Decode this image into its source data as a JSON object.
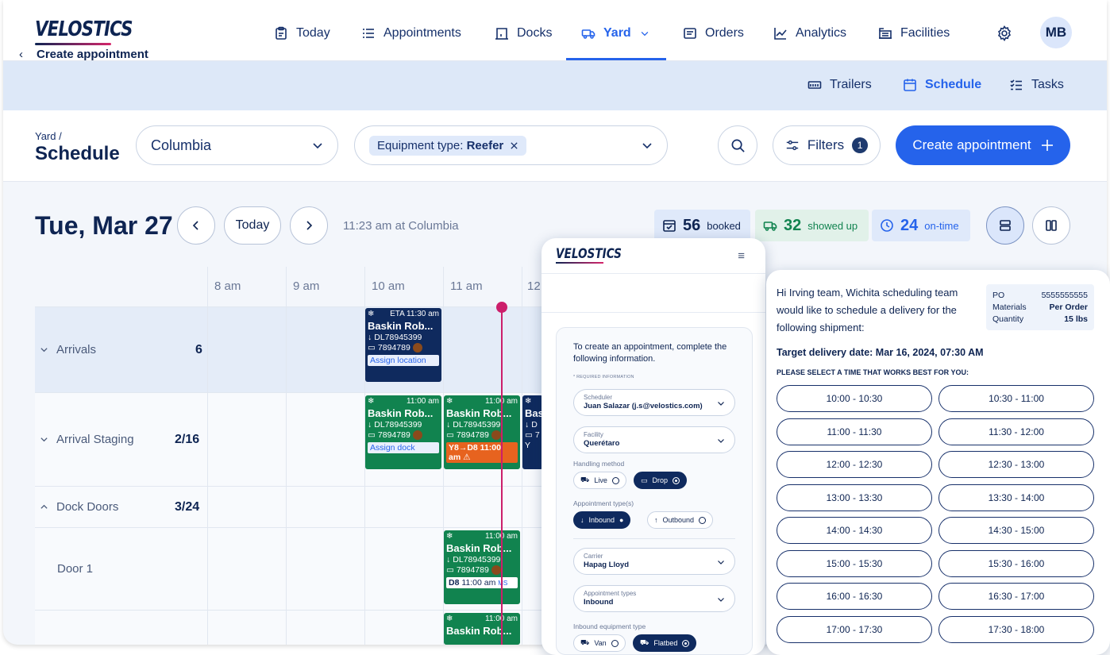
{
  "brand": "VELOSTICS",
  "nav": {
    "items": [
      {
        "label": "Today",
        "icon": "clipboard-icon"
      },
      {
        "label": "Appointments",
        "icon": "list-icon"
      },
      {
        "label": "Docks",
        "icon": "dock-icon"
      },
      {
        "label": "Yard",
        "icon": "truck-icon",
        "active": true
      },
      {
        "label": "Orders",
        "icon": "orders-icon"
      },
      {
        "label": "Analytics",
        "icon": "chart-line-icon"
      },
      {
        "label": "Facilities",
        "icon": "facility-icon"
      }
    ],
    "user_initials": "MB"
  },
  "subnav": {
    "trailers": "Trailers",
    "schedule": "Schedule",
    "tasks": "Tasks"
  },
  "filterbar": {
    "crumb": "Yard /",
    "title": "Schedule",
    "facility": "Columbia",
    "equipment_label": "Equipment type:",
    "equipment_value": "Reefer",
    "filters_label": "Filters",
    "filters_count": "1",
    "create_label": "Create appointment"
  },
  "schedule": {
    "date": "Tue, Mar 27",
    "today_label": "Today",
    "time_note": "11:23 am at Columbia",
    "stats": {
      "booked_num": "56",
      "booked_label": "booked",
      "showed_num": "32",
      "showed_label": "showed up",
      "ontime_num": "24",
      "ontime_label": "on-time"
    },
    "hours": [
      "8 am",
      "9 am",
      "10 am",
      "11 am",
      "12"
    ],
    "rows": [
      {
        "label": "Arrivals",
        "count": "6"
      },
      {
        "label": "Arrival Staging",
        "count": "2/16"
      },
      {
        "label": "Dock Doors",
        "count": "3/24"
      },
      {
        "label": "Door 1",
        "count": ""
      }
    ],
    "cards": {
      "arrival": {
        "time": "ETA 11:30 am",
        "name": "Baskin Rob...",
        "load": "DL78945399",
        "trailer": "7894789",
        "action": "Assign location"
      },
      "staging1": {
        "time": "11:00 am",
        "name": "Baskin Rob...",
        "load": "DL78945399",
        "trailer": "7894789",
        "action": "Assign dock"
      },
      "staging2": {
        "time": "11:00 am",
        "name": "Baskin Rob...",
        "load": "DL78945399",
        "trailer": "7894789",
        "move": "Y8→D8 11:00 am"
      },
      "staging3": {
        "name": "Bas",
        "load": "D",
        "trailer": "7",
        "move": "Y"
      },
      "door1": {
        "time": "11:00 am",
        "name": "Baskin Rob...",
        "load": "DL78945399",
        "trailer": "7894789",
        "dock": "D8",
        "dock_time": "11:00 am",
        "user": "MS"
      },
      "door1b": {
        "time": "11:00 am",
        "name": "Baskin Rob..."
      }
    }
  },
  "mobile": {
    "brand": "VELOSTICS",
    "title": "Create appointment",
    "intro": "To create an appointment, complete the following information.",
    "required": "* REQUIRED INFORMATION",
    "scheduler_label": "Scheduler",
    "scheduler_value": "Juan Salazar (j.s@velostics.com)",
    "facility_label": "Facility",
    "facility_value": "Querétaro",
    "handling_label": "Handling method",
    "handling_live": "Live",
    "handling_drop": "Drop",
    "appt_type_label": "Appointment type(s)",
    "inbound": "Inbound",
    "outbound": "Outbound",
    "carrier_label": "Carrier",
    "carrier_value": "Hapag Lloyd",
    "appt_types_label": "Appointment types",
    "appt_types_value": "Inbound",
    "equip_label": "Inbound equipment type",
    "equip_van": "Van",
    "equip_flatbed": "Flatbed"
  },
  "email": {
    "message": "Hi Irving team, Wichita scheduling team would like to schedule a delivery for the following shipment:",
    "po_label": "PO",
    "po_value": "5555555555",
    "materials_label": "Materials",
    "materials_value": "Per Order",
    "quantity_label": "Quantity",
    "quantity_value": "15 lbs",
    "target": "Target delivery date: Mar 16, 2024, 07:30 AM",
    "please": "PLEASE SELECT A TIME THAT WORKS BEST FOR YOU:",
    "slots": [
      "10:00 - 10:30",
      "10:30 - 11:00",
      "11:00 - 11:30",
      "11:30 - 12:00",
      "12:00 - 12:30",
      "12:30 - 13:00",
      "13:00 - 13:30",
      "13:30 - 14:00",
      "14:00 - 14:30",
      "14:30 - 15:00",
      "15:00 - 15:30",
      "15:30 - 16:00",
      "16:00 - 16:30",
      "16:30 - 17:00",
      "17:00 - 17:30",
      "17:30 - 18:00"
    ]
  },
  "colors": {
    "primary": "#2563eb",
    "navy": "#0f2a5e",
    "green": "#11834f",
    "orange": "#e7631f",
    "now_line": "#cc1f6b"
  }
}
